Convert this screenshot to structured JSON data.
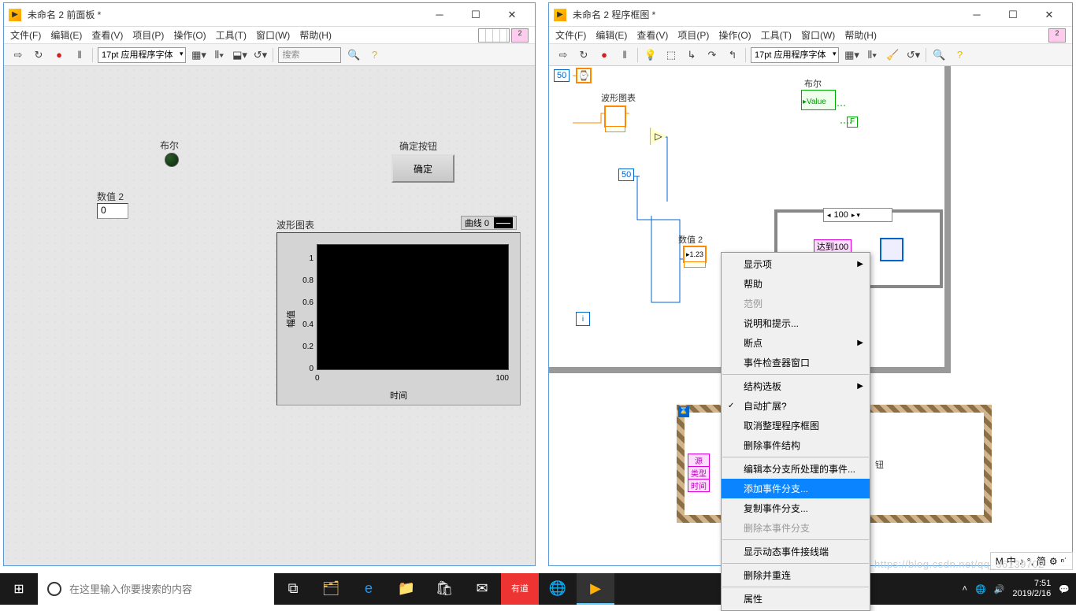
{
  "front_panel": {
    "title": "未命名 2 前面板 *",
    "menu": [
      "文件(F)",
      "编辑(E)",
      "查看(V)",
      "项目(P)",
      "操作(O)",
      "工具(T)",
      "窗口(W)",
      "帮助(H)"
    ],
    "font": "17pt 应用程序字体",
    "search_placeholder": "搜索",
    "controls": {
      "bool_label": "布尔",
      "num_label": "数值 2",
      "num_value": "0",
      "ok_section": "确定按钮",
      "ok_btn": "确定"
    },
    "chart": {
      "title": "波形图表",
      "legend": "曲线 0",
      "xlabel": "时间",
      "ylabel": "幅值",
      "xticks": [
        "0",
        "100"
      ],
      "yticks": [
        "0",
        "0.2",
        "0.4",
        "0.6",
        "0.8",
        "1"
      ]
    }
  },
  "block_diagram": {
    "title": "未命名 2 程序框图 *",
    "menu": [
      "文件(F)",
      "编辑(E)",
      "查看(V)",
      "项目(P)",
      "操作(O)",
      "工具(T)",
      "窗口(W)",
      "帮助(H)"
    ],
    "font": "17pt 应用程序字体",
    "const50a": "50",
    "const50b": "50",
    "chart_label": "波形图表",
    "bool_label": "布尔",
    "value_label": "Value",
    "f_const": "F",
    "num_label": "数值 2",
    "num_icon": "1.23",
    "reach100": "达到100",
    "case_100": "100",
    "event_labels": {
      "source": "源",
      "type": "类型",
      "time": "时间"
    },
    "ok_hint": "钮"
  },
  "context_menu": {
    "items": [
      {
        "label": "显示项",
        "sub": true
      },
      {
        "label": "帮助"
      },
      {
        "label": "范例",
        "disabled": true
      },
      {
        "label": "说明和提示..."
      },
      {
        "label": "断点",
        "sub": true
      },
      {
        "label": "事件检查器窗口"
      },
      {
        "sep": true
      },
      {
        "label": "结构选板",
        "sub": true
      },
      {
        "label": "自动扩展?",
        "check": true
      },
      {
        "label": "取消整理程序框图"
      },
      {
        "label": "删除事件结构"
      },
      {
        "sep": true
      },
      {
        "label": "编辑本分支所处理的事件..."
      },
      {
        "label": "添加事件分支...",
        "active": true
      },
      {
        "label": "复制事件分支..."
      },
      {
        "label": "删除本事件分支",
        "disabled": true
      },
      {
        "sep": true
      },
      {
        "label": "显示动态事件接线端"
      },
      {
        "sep": true
      },
      {
        "label": "删除并重连"
      },
      {
        "sep": true
      },
      {
        "label": "属性"
      }
    ]
  },
  "chart_data": {
    "type": "line",
    "title": "波形图表",
    "xlabel": "时间",
    "ylabel": "幅值",
    "xlim": [
      0,
      100
    ],
    "ylim": [
      0,
      1
    ],
    "x_ticks": [
      0,
      100
    ],
    "y_ticks": [
      0,
      0.2,
      0.4,
      0.6,
      0.8,
      1
    ],
    "series": [
      {
        "name": "曲线 0",
        "values": []
      }
    ]
  },
  "taskbar": {
    "search_placeholder": "在这里输入你要搜索的内容",
    "time": "7:51",
    "date": "2019/2/16"
  },
  "tray": {
    "items": [
      "M",
      "中",
      "♪",
      "°,",
      "简",
      "⚙",
      "ⁿ˙"
    ]
  },
  "watermark": "https://blog.csdn.net/qq_36139702"
}
